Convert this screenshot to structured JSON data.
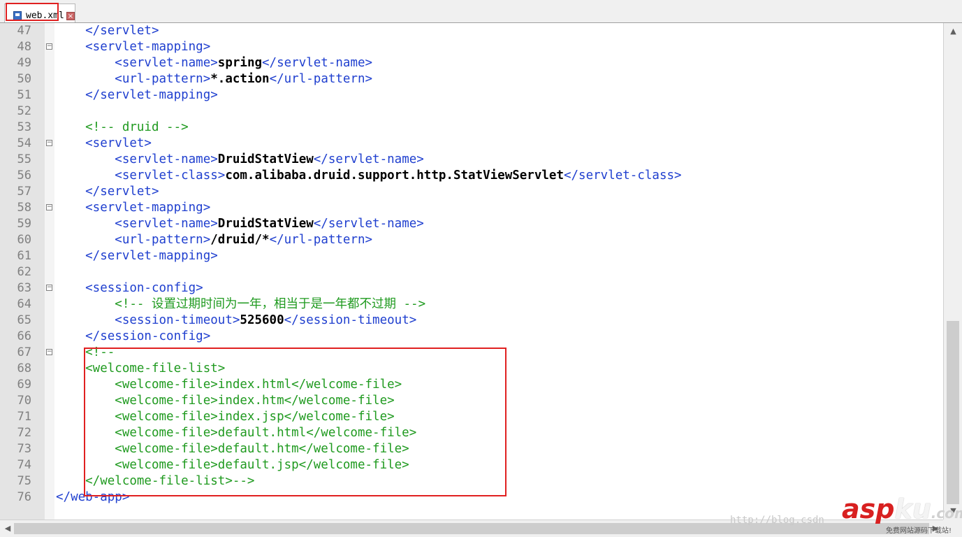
{
  "tab": {
    "label": "web.xml",
    "close": "×"
  },
  "lines": [
    {
      "n": "47",
      "fold": "",
      "segs": [
        [
          "t",
          "    </servlet>"
        ]
      ]
    },
    {
      "n": "48",
      "fold": "−",
      "segs": [
        [
          "t",
          "    <servlet-mapping>"
        ]
      ]
    },
    {
      "n": "49",
      "fold": "",
      "segs": [
        [
          "t",
          "        <servlet-name>"
        ],
        [
          "x",
          "spring"
        ],
        [
          "t",
          "</servlet-name>"
        ]
      ]
    },
    {
      "n": "50",
      "fold": "",
      "segs": [
        [
          "t",
          "        <url-pattern>"
        ],
        [
          "x",
          "*.action"
        ],
        [
          "t",
          "</url-pattern>"
        ]
      ]
    },
    {
      "n": "51",
      "fold": "",
      "segs": [
        [
          "t",
          "    </servlet-mapping>"
        ]
      ]
    },
    {
      "n": "52",
      "fold": "",
      "segs": []
    },
    {
      "n": "53",
      "fold": "",
      "segs": [
        [
          "c",
          "    <!-- druid -->"
        ]
      ]
    },
    {
      "n": "54",
      "fold": "−",
      "segs": [
        [
          "t",
          "    <servlet>"
        ]
      ]
    },
    {
      "n": "55",
      "fold": "",
      "segs": [
        [
          "t",
          "        <servlet-name>"
        ],
        [
          "x",
          "DruidStatView"
        ],
        [
          "t",
          "</servlet-name>"
        ]
      ]
    },
    {
      "n": "56",
      "fold": "",
      "segs": [
        [
          "t",
          "        <servlet-class>"
        ],
        [
          "x",
          "com.alibaba.druid.support.http.StatViewServlet"
        ],
        [
          "t",
          "</servlet-class>"
        ]
      ]
    },
    {
      "n": "57",
      "fold": "",
      "segs": [
        [
          "t",
          "    </servlet>"
        ]
      ]
    },
    {
      "n": "58",
      "fold": "−",
      "segs": [
        [
          "t",
          "    <servlet-mapping>"
        ]
      ]
    },
    {
      "n": "59",
      "fold": "",
      "segs": [
        [
          "t",
          "        <servlet-name>"
        ],
        [
          "x",
          "DruidStatView"
        ],
        [
          "t",
          "</servlet-name>"
        ]
      ]
    },
    {
      "n": "60",
      "fold": "",
      "segs": [
        [
          "t",
          "        <url-pattern>"
        ],
        [
          "x",
          "/druid/*"
        ],
        [
          "t",
          "</url-pattern>"
        ]
      ]
    },
    {
      "n": "61",
      "fold": "",
      "segs": [
        [
          "t",
          "    </servlet-mapping>"
        ]
      ]
    },
    {
      "n": "62",
      "fold": "",
      "segs": []
    },
    {
      "n": "63",
      "fold": "−",
      "segs": [
        [
          "t",
          "    <session-config>"
        ]
      ]
    },
    {
      "n": "64",
      "fold": "",
      "segs": [
        [
          "c",
          "        <!-- 设置过期时间为一年，相当于是一年都不过期 -->"
        ]
      ]
    },
    {
      "n": "65",
      "fold": "",
      "segs": [
        [
          "t",
          "        <session-timeout>"
        ],
        [
          "x",
          "525600"
        ],
        [
          "t",
          "</session-timeout>"
        ]
      ]
    },
    {
      "n": "66",
      "fold": "",
      "segs": [
        [
          "t",
          "    </session-config>"
        ]
      ]
    },
    {
      "n": "67",
      "fold": "−",
      "segs": [
        [
          "c",
          "    <!--"
        ]
      ]
    },
    {
      "n": "68",
      "fold": "",
      "segs": [
        [
          "c",
          "    <welcome-file-list>"
        ]
      ]
    },
    {
      "n": "69",
      "fold": "",
      "segs": [
        [
          "c",
          "        <welcome-file>index.html</welcome-file>"
        ]
      ]
    },
    {
      "n": "70",
      "fold": "",
      "segs": [
        [
          "c",
          "        <welcome-file>index.htm</welcome-file>"
        ]
      ]
    },
    {
      "n": "71",
      "fold": "",
      "segs": [
        [
          "c",
          "        <welcome-file>index.jsp</welcome-file>"
        ]
      ]
    },
    {
      "n": "72",
      "fold": "",
      "segs": [
        [
          "c",
          "        <welcome-file>default.html</welcome-file>"
        ]
      ]
    },
    {
      "n": "73",
      "fold": "",
      "segs": [
        [
          "c",
          "        <welcome-file>default.htm</welcome-file>"
        ]
      ]
    },
    {
      "n": "74",
      "fold": "",
      "segs": [
        [
          "c",
          "        <welcome-file>default.jsp</welcome-file>"
        ]
      ]
    },
    {
      "n": "75",
      "fold": "",
      "segs": [
        [
          "c",
          "    </welcome-file-list>-->"
        ]
      ]
    },
    {
      "n": "76",
      "fold": "",
      "segs": [
        [
          "t",
          "</web-app>"
        ]
      ]
    }
  ],
  "watermark": {
    "url": "http://blog.csdn",
    "logo_a": "asp",
    "logo_b": "ku",
    "logo_c": ".com",
    "sub": "免费网站源码下载站!"
  },
  "colors": {
    "tag": "#1f3fcf",
    "text": "#000000",
    "comment": "#1f9a1f",
    "highlight": "#e02020"
  }
}
